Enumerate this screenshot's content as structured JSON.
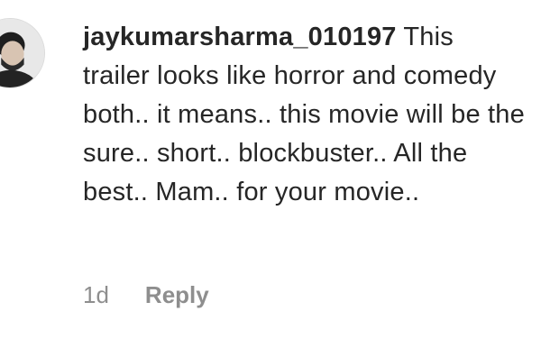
{
  "comment": {
    "username": "jaykumarsharma_010197",
    "text": "This trailer looks like horror and comedy both.. it means.. this movie will be the sure.. short.. blockbuster.. All the best.. Mam.. for your movie..",
    "time": "1d",
    "reply_label": "Reply",
    "avatar_icon": "profile-avatar"
  }
}
